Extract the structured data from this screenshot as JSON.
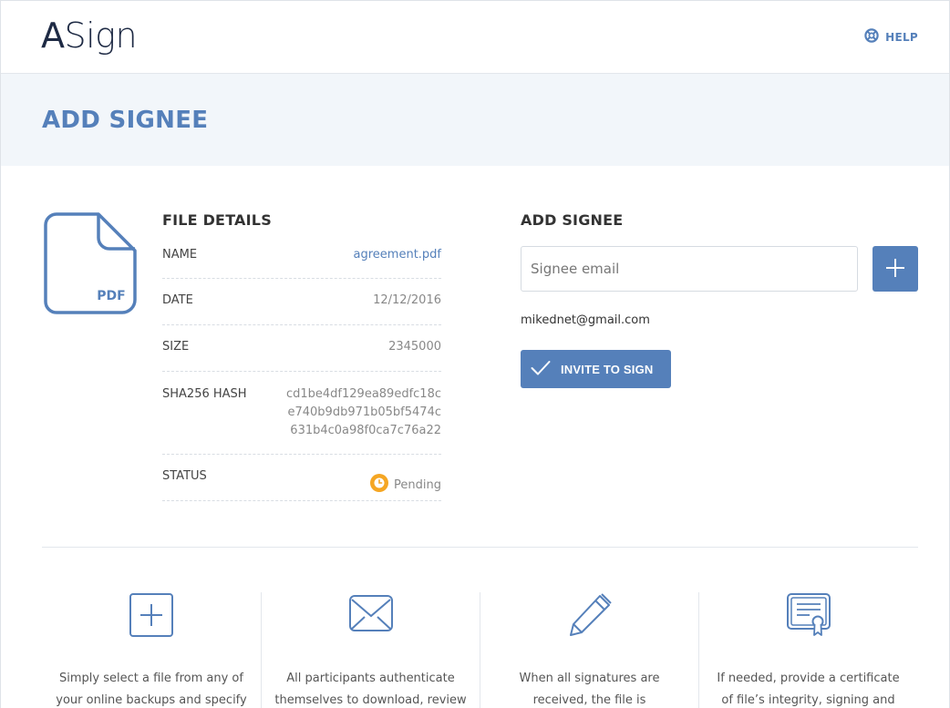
{
  "app": {
    "logo_text": "ASign",
    "logo_first": "A",
    "logo_rest": "Sign"
  },
  "header": {
    "help_label": "HELP",
    "help_icon": "lifebuoy-icon"
  },
  "page": {
    "title": "ADD SIGNEE"
  },
  "file_icon": {
    "label": "PDF",
    "icon": "pdf-file-icon"
  },
  "file_details": {
    "title": "FILE DETAILS",
    "name_label": "NAME",
    "name_value": "agreement.pdf",
    "date_label": "DATE",
    "date_value": "12/12/2016",
    "size_label": "SIZE",
    "size_value": "2345000",
    "hash_label": "SHA256 HASH",
    "hash_line1": "cd1be4df129ea89edfc18c",
    "hash_line2": "e740b9db971b05bf5474c",
    "hash_line3": "631b4c0a98f0ca7c76a22",
    "status_label": "STATUS",
    "status_value": "Pending",
    "status_icon": "clock-icon",
    "status_color": "#f5a623"
  },
  "add_signee": {
    "title": "ADD SIGNEE",
    "email_placeholder": "Signee email",
    "email_value": "",
    "add_icon": "plus-icon",
    "signees": [
      "mikednet@gmail.com"
    ],
    "invite_label": "INVITE TO SIGN",
    "invite_icon": "checkmark-icon"
  },
  "features": [
    {
      "icon": "add-file-icon",
      "text": "Simply select a file from any of your online backups and specify"
    },
    {
      "icon": "envelope-icon",
      "text": "All participants authenticate themselves to download, review"
    },
    {
      "icon": "pen-icon",
      "text": "When all signatures are received, the file is electronically"
    },
    {
      "icon": "certificate-icon",
      "text": "If needed, provide a certificate of file’s integrity, signing and"
    }
  ],
  "colors": {
    "accent": "#5580ba",
    "band": "#f2f6fa",
    "pending": "#f5a623",
    "logo": "#1e2a44"
  }
}
